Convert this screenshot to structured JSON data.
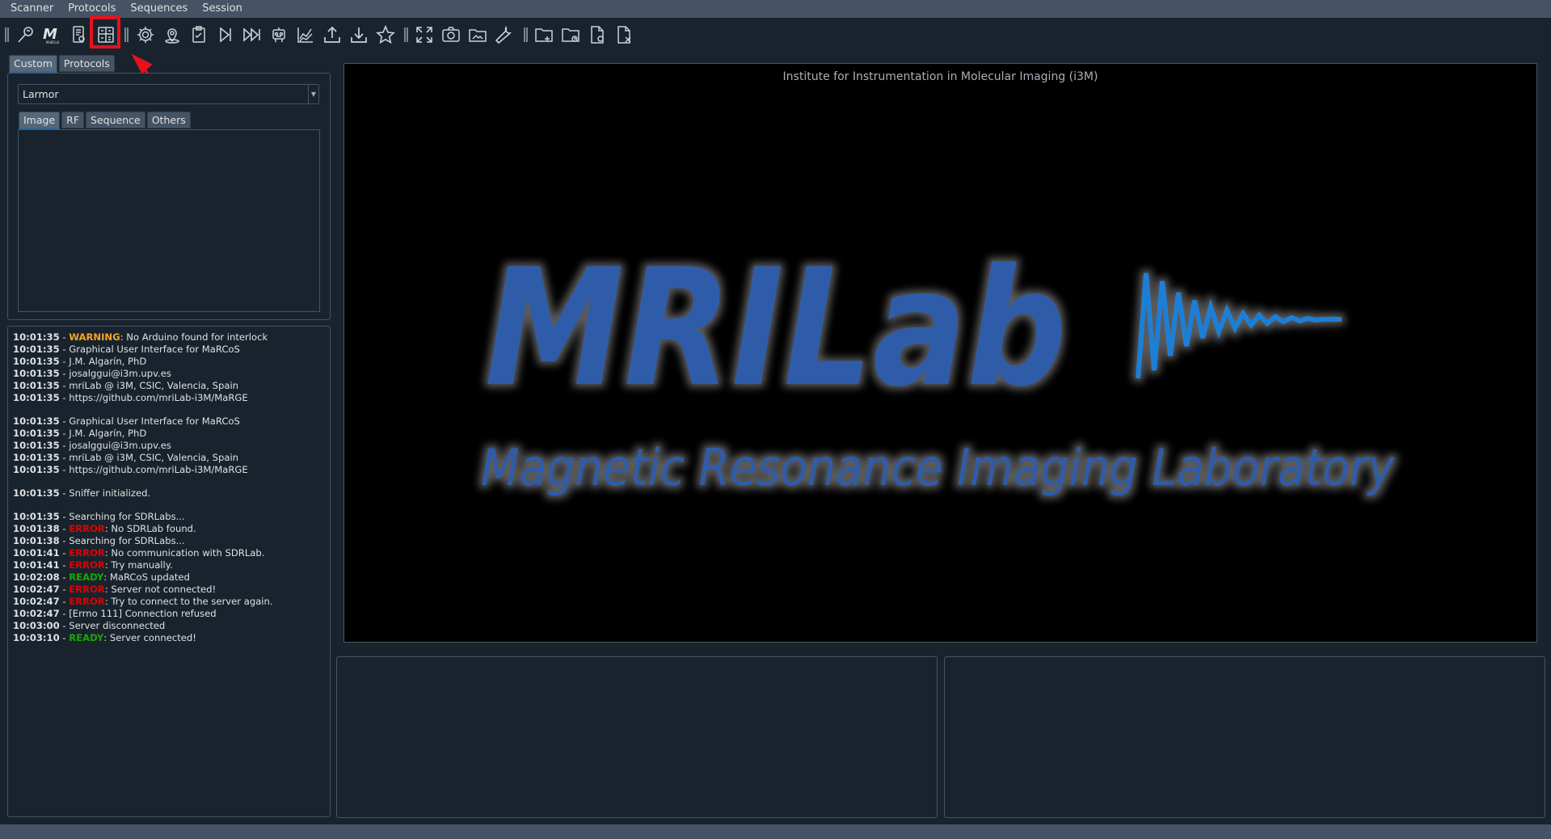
{
  "menu": [
    "Scanner",
    "Protocols",
    "Sequences",
    "Session"
  ],
  "toolbar_icons": [
    "magnifier-icon",
    "marcos-logo-icon",
    "scanner-file-icon",
    "calculator-icon",
    "settings-icon",
    "map-pin-icon",
    "clipboard-icon",
    "step-forward-icon",
    "fast-forward-icon",
    "robot-icon",
    "chart-icon",
    "upload-icon",
    "download-icon",
    "star-icon",
    "fullscreen-icon",
    "camera-icon",
    "image-folder-icon",
    "wrench-icon",
    "new-folder-icon",
    "open-folder-icon",
    "file-icon",
    "close-file-icon"
  ],
  "left_tabs": {
    "custom": "Custom",
    "protocols": "Protocols"
  },
  "sequence_combo": {
    "value": "Larmor"
  },
  "param_tabs": {
    "image": "Image",
    "rf": "RF",
    "sequence": "Sequence",
    "others": "Others"
  },
  "log": [
    {
      "t": "10:01:35",
      "sep": " - ",
      "tag": "WARNING",
      "cls": "warn",
      "msg": ": No Arduino found for interlock"
    },
    {
      "t": "10:01:35",
      "sep": " - ",
      "tag": "",
      "cls": "",
      "msg": "Graphical User Interface for MaRCoS"
    },
    {
      "t": "10:01:35",
      "sep": " - ",
      "tag": "",
      "cls": "",
      "msg": "J.M. Algarín, PhD"
    },
    {
      "t": "10:01:35",
      "sep": " - ",
      "tag": "",
      "cls": "",
      "msg": "josalggui@i3m.upv.es"
    },
    {
      "t": "10:01:35",
      "sep": " - ",
      "tag": "",
      "cls": "",
      "msg": "mriLab @ i3M, CSIC, Valencia, Spain"
    },
    {
      "t": "10:01:35",
      "sep": " - ",
      "tag": "",
      "cls": "",
      "msg": "https://github.com/mriLab-i3M/MaRGE"
    },
    {
      "gap": true
    },
    {
      "t": "10:01:35",
      "sep": " - ",
      "tag": "",
      "cls": "",
      "msg": "Graphical User Interface for MaRCoS"
    },
    {
      "t": "10:01:35",
      "sep": " - ",
      "tag": "",
      "cls": "",
      "msg": "J.M. Algarín, PhD"
    },
    {
      "t": "10:01:35",
      "sep": " - ",
      "tag": "",
      "cls": "",
      "msg": "josalggui@i3m.upv.es"
    },
    {
      "t": "10:01:35",
      "sep": " - ",
      "tag": "",
      "cls": "",
      "msg": "mriLab @ i3M, CSIC, Valencia, Spain"
    },
    {
      "t": "10:01:35",
      "sep": " - ",
      "tag": "",
      "cls": "",
      "msg": "https://github.com/mriLab-i3M/MaRGE"
    },
    {
      "gap": true
    },
    {
      "t": "10:01:35",
      "sep": " - ",
      "tag": "",
      "cls": "",
      "msg": "Sniffer initialized."
    },
    {
      "gap": true
    },
    {
      "t": "10:01:35",
      "sep": " - ",
      "tag": "",
      "cls": "",
      "msg": "Searching for SDRLabs..."
    },
    {
      "t": "10:01:38",
      "sep": " - ",
      "tag": "ERROR",
      "cls": "err",
      "msg": ": No SDRLab found."
    },
    {
      "t": "10:01:38",
      "sep": " - ",
      "tag": "",
      "cls": "",
      "msg": "Searching for SDRLabs..."
    },
    {
      "t": "10:01:41",
      "sep": " - ",
      "tag": "ERROR",
      "cls": "err",
      "msg": ": No communication with SDRLab."
    },
    {
      "t": "10:01:41",
      "sep": " - ",
      "tag": "ERROR",
      "cls": "err",
      "msg": ": Try manually."
    },
    {
      "t": "10:02:08",
      "sep": " - ",
      "tag": "READY",
      "cls": "ready",
      "msg": ": MaRCoS updated"
    },
    {
      "t": "10:02:47",
      "sep": " - ",
      "tag": "ERROR",
      "cls": "err",
      "msg": ": Server not connected!"
    },
    {
      "t": "10:02:47",
      "sep": " - ",
      "tag": "ERROR",
      "cls": "err",
      "msg": ": Try to connect to the server again."
    },
    {
      "t": "10:02:47",
      "sep": " - ",
      "tag": "",
      "cls": "",
      "msg": "[Errno 111] Connection refused"
    },
    {
      "t": "10:03:00",
      "sep": " - ",
      "tag": "",
      "cls": "",
      "msg": "Server disconnected"
    },
    {
      "t": "10:03:10",
      "sep": " - ",
      "tag": "READY",
      "cls": "ready",
      "msg": ": Server connected!"
    }
  ],
  "viewer": {
    "title": "Institute for Instrumentation in Molecular Imaging (i3M)",
    "logo_text": "MRILab",
    "logo_subtitle": "Magnetic Resonance Imaging Laboratory"
  },
  "colors": {
    "accent": "#346792",
    "logo_blue": "#2d5ca8",
    "wave_blue": "#1a7fd6",
    "highlight": "#e8111b"
  }
}
